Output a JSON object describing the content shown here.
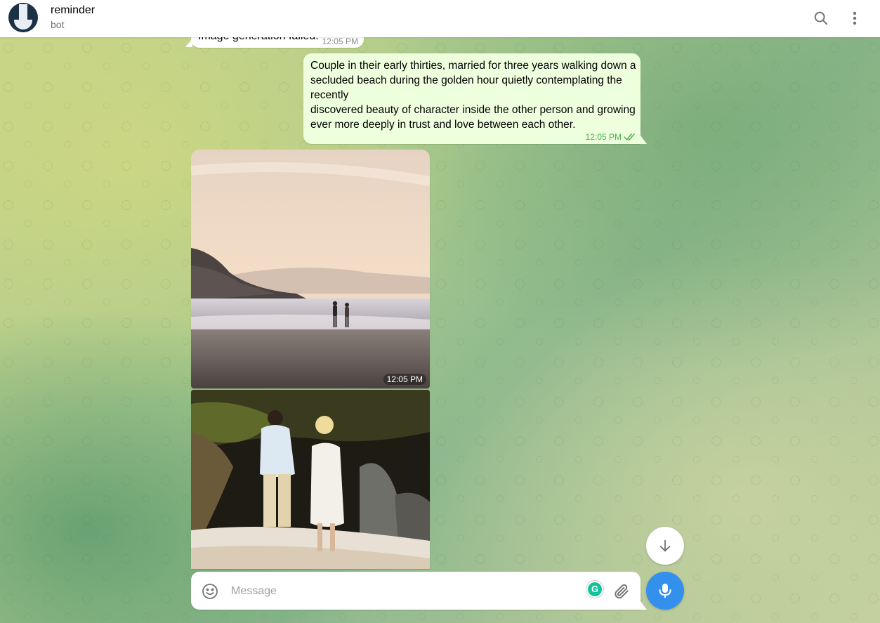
{
  "header": {
    "chat_name": "reminder",
    "chat_status": "bot",
    "icons": [
      "search-icon",
      "more-vertical-icon"
    ]
  },
  "messages": [
    {
      "direction": "incoming",
      "text": "Image generation failed.",
      "time": "12:05 PM"
    },
    {
      "direction": "outgoing",
      "text": "Couple in their early thirties, married for three years walking down a secluded beach during the golden hour quietly contemplating the recently\n discovered beauty of character inside the other person and growing ever more deeply in trust and love between each other.",
      "time": "12:05 PM",
      "status": "read"
    },
    {
      "direction": "incoming",
      "type": "photo",
      "subject": "couple walking on misty beach at sunset",
      "time": "12:05 PM"
    },
    {
      "direction": "incoming",
      "type": "photo",
      "subject": "couple walking toward rocks on beach"
    }
  ],
  "composer": {
    "placeholder": "Message",
    "value": "",
    "grammarly_letter": "G"
  },
  "colors": {
    "outgoing_bubble": "#eeffde",
    "accent": "#3390ec",
    "read_check": "#4fae4e"
  }
}
